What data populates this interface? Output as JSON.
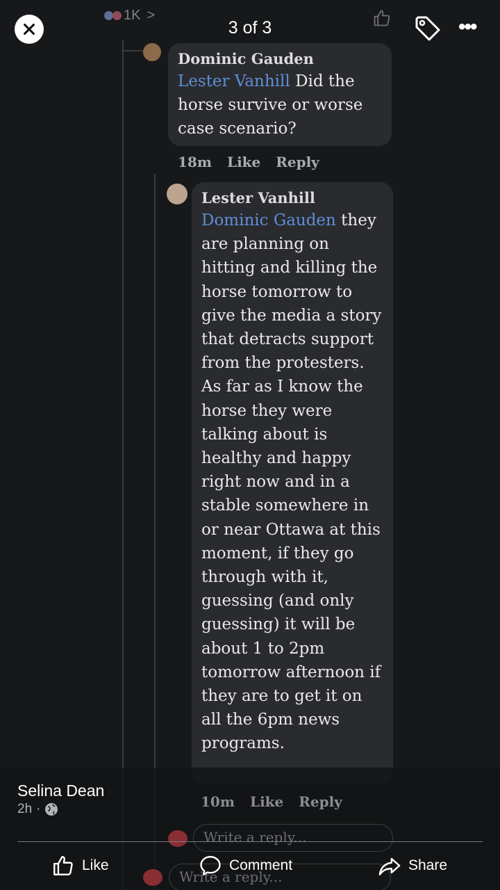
{
  "viewer": {
    "reaction_count": "1K",
    "reaction_chevron": ">",
    "page_counter": "3 of 3",
    "more_label": "•••"
  },
  "thread": {
    "comment1": {
      "author": "Dominic Gauden",
      "mention": "Lester Vanhill",
      "text": " Did the horse survive or worse case scenario?",
      "time": "18m",
      "like": "Like",
      "reply": "Reply"
    },
    "comment2": {
      "author": "Lester Vanhill",
      "mention": "Dominic Gauden",
      "text": " they are planning on hitting and killing the horse tomorrow to give the media a story that detracts support from the protesters. As far as I know the horse they were talking about is healthy and happy right now and in a stable somewhere in or near Ottawa at this moment, if they go through with it, guessing (and only guessing) it will be about 1 to 2pm tomorrow afternoon if they are to get it on all the 6pm news programs.",
      "time": "10m",
      "like": "Like",
      "reply": "Reply"
    },
    "write_reply_placeholder": "Write a reply...",
    "write_reply_placeholder_outer": "Write a reply..."
  },
  "post": {
    "poster_name": "Selina Dean",
    "time": "2h",
    "separator": "·",
    "actions": {
      "like": "Like",
      "comment": "Comment",
      "share": "Share"
    }
  },
  "colors": {
    "background": "#17181a",
    "bubble": "#2a2b2f",
    "mention": "#5f8fd6"
  }
}
